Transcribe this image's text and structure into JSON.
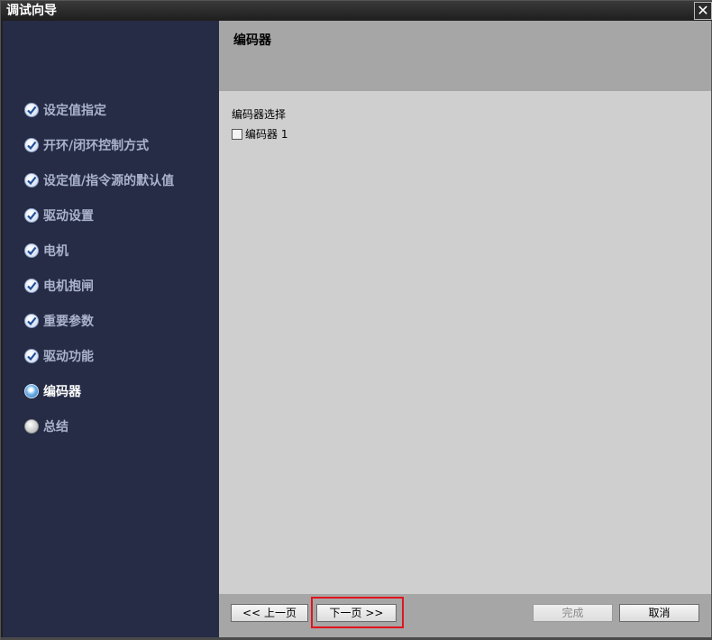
{
  "window": {
    "title": "调试向导",
    "close_label": "✕"
  },
  "steps": [
    {
      "label": "设定值指定",
      "state": "done"
    },
    {
      "label": "开环/闭环控制方式",
      "state": "done"
    },
    {
      "label": "设定值/指令源的默认值",
      "state": "done"
    },
    {
      "label": "驱动设置",
      "state": "done"
    },
    {
      "label": "电机",
      "state": "done"
    },
    {
      "label": "电机抱闸",
      "state": "done"
    },
    {
      "label": "重要参数",
      "state": "done"
    },
    {
      "label": "驱动功能",
      "state": "done"
    },
    {
      "label": "编码器",
      "state": "active"
    },
    {
      "label": "总结",
      "state": "pending"
    }
  ],
  "header": {
    "title": "编码器"
  },
  "content": {
    "section_label": "编码器选择",
    "checkbox_label": "编码器 1",
    "checkbox_checked": false
  },
  "footer": {
    "prev_label": "<< 上一页",
    "next_label": "下一页 >>",
    "finish_label": "完成",
    "cancel_label": "取消"
  },
  "colors": {
    "sidebar_bg": "#262c45",
    "header_bg": "#a6a6a6",
    "content_bg": "#cfcfcf",
    "highlight": "#e0151e"
  }
}
